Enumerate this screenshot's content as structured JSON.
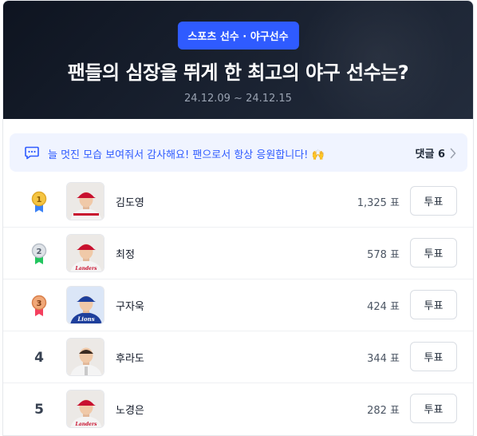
{
  "header": {
    "category": "스포츠 선수 · 야구선수",
    "title": "팬들의 심장을 뛰게 한 최고의 야구 선수는?",
    "period": "24.12.09 ~ 24.12.15"
  },
  "notice": {
    "text": "늘 멋진 모습 보여줘서 감사해요! 팬으로서 항상 응원합니다! 🙌",
    "comments_label": "댓글 6",
    "accent": "#2f5bff"
  },
  "vote_label": "투표",
  "players": [
    {
      "rank": "1",
      "medal": "gold",
      "name": "김도영",
      "votes": "1,325 표",
      "jersey": "red-white",
      "cap": "#c8102e"
    },
    {
      "rank": "2",
      "medal": "silver",
      "name": "최정",
      "votes": "578 표",
      "jersey": "landers",
      "cap": "#c8102e"
    },
    {
      "rank": "3",
      "medal": "bronze",
      "name": "구자욱",
      "votes": "424 표",
      "jersey": "lions",
      "cap": "#1e3f9c"
    },
    {
      "rank": "4",
      "medal": "",
      "name": "후라도",
      "votes": "344 표",
      "jersey": "white",
      "cap": ""
    },
    {
      "rank": "5",
      "medal": "",
      "name": "노경은",
      "votes": "282 표",
      "jersey": "landers",
      "cap": "#c8102e"
    }
  ]
}
